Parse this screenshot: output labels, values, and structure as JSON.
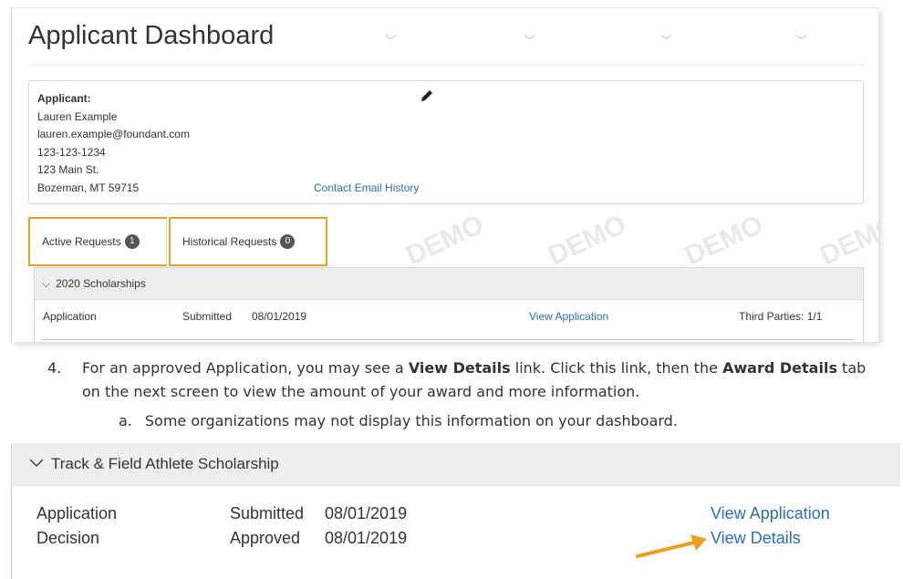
{
  "dashboard": {
    "title": "Applicant Dashboard",
    "watermark": "DEMO",
    "applicant": {
      "label": "Applicant:",
      "name": "Lauren Example",
      "email": "lauren.example@foundant.com",
      "phone": "123-123-1234",
      "address1": "123 Main St.",
      "address2": "Bozeman, MT 59715",
      "edit_icon": "pencil-icon",
      "contact_link": "Contact Email History"
    },
    "tabs": [
      {
        "label": "Active Requests",
        "count": "1"
      },
      {
        "label": "Historical Requests",
        "count": "0"
      }
    ],
    "group": {
      "title": "2020 Scholarships",
      "row": {
        "type": "Application",
        "status": "Submitted",
        "date": "08/01/2019",
        "link": "View Application",
        "third_parties": "Third Parties: 1/1"
      }
    }
  },
  "instructions": {
    "step_num": "4.",
    "step_pre": "For an approved Application, you may see a ",
    "step_bold1": "View Details",
    "step_mid": " link. Click this link, then the ",
    "step_bold2": "Award Details",
    "step_post": " tab on the next screen to view the amount of your award and more information.",
    "sub_num": "a.",
    "sub_text": "Some organizations may not display this information on your dashboard."
  },
  "scholarship": {
    "title": "Track & Field Athlete Scholarship",
    "rows": [
      {
        "type": "Application",
        "status": "Submitted",
        "date": "08/01/2019",
        "link": "View Application"
      },
      {
        "type": "Decision",
        "status": "Approved",
        "date": "08/01/2019",
        "link": "View Details"
      }
    ],
    "arrow_color": "#e8a023"
  }
}
